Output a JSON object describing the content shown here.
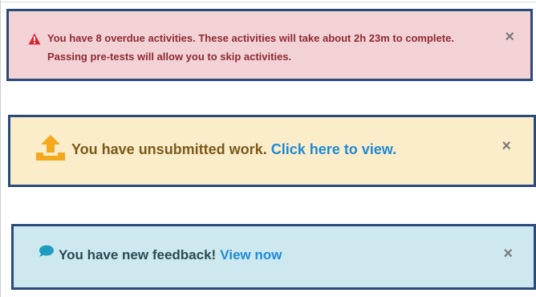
{
  "alerts": {
    "overdue": {
      "text": "You have 8 overdue activities. These activities will take about 2h 23m to complete. Passing pre-tests will allow you to skip activities.",
      "close": "×",
      "icon": "warning-triangle-icon",
      "color": "#f3d2d6"
    },
    "unsubmitted": {
      "text": "You have unsubmitted work.",
      "link": "Click here to view.",
      "close": "×",
      "icon": "upload-icon",
      "color": "#fbedc9"
    },
    "feedback": {
      "text": "You have new feedback!",
      "link": "View now",
      "close": "×",
      "icon": "speech-bubble-icon",
      "color": "#cde9ef"
    }
  },
  "colors": {
    "border": "#2a4a7a",
    "link": "#1f8ad6"
  }
}
